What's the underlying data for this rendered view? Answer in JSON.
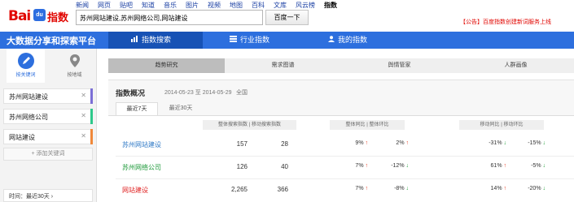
{
  "header": {
    "logo_text": "Bai",
    "logo_paw": "du",
    "logo_suffix": "指数",
    "nav": [
      "新闻",
      "网页",
      "贴吧",
      "知道",
      "音乐",
      "图片",
      "视频",
      "地图",
      "百科",
      "文库",
      "风云榜",
      "指数"
    ],
    "search_value": "苏州网站建设,苏州网络公司,网站建设",
    "search_button": "百度一下",
    "announcement": "【公告】百度指数创建新词服务上线"
  },
  "bluebar": {
    "brand": "大数据分享和探索平台",
    "nav": [
      {
        "label": "指数搜索",
        "icon": "chart-bar-icon"
      },
      {
        "label": "行业指数",
        "icon": "layers-icon"
      },
      {
        "label": "我的指数",
        "icon": "user-icon"
      }
    ]
  },
  "sidebar": {
    "tabs": [
      {
        "label": "按关键词",
        "icon": "pencil-icon"
      },
      {
        "label": "按地域",
        "icon": "map-pin-icon"
      }
    ],
    "keywords": [
      {
        "label": "苏州网站建设",
        "color": "#7b6fd6"
      },
      {
        "label": "苏州网络公司",
        "color": "#2ec98b"
      },
      {
        "label": "网站建设",
        "color": "#f0883a"
      }
    ],
    "add_keyword": "+ 添加关键词",
    "time": "时间：最近30天 ›"
  },
  "main": {
    "tabs": [
      "趋势研究",
      "需求图谱",
      "舆情管家",
      "人群画像"
    ],
    "title": "指数概况",
    "date_from": "2014-05-23",
    "date_to_sep": "至",
    "date_to": "2014-05-29",
    "region": "全国",
    "day_tabs": [
      "最近7天",
      "最近30天"
    ],
    "col_heads": [
      "整体搜索指数 | 移动搜索指数",
      "整体同比 | 整体环比",
      "移动同比 | 移动环比"
    ],
    "rows": [
      {
        "keyword": "苏州网站建设",
        "overall": "157",
        "mobile": "28",
        "yoy": "9%",
        "yoy_dir": "up",
        "mom": "2%",
        "mom_dir": "up",
        "m_yoy": "-31%",
        "m_yoy_dir": "down",
        "m_mom": "-15%",
        "m_mom_dir": "down",
        "color": "blue"
      },
      {
        "keyword": "苏州网络公司",
        "overall": "126",
        "mobile": "40",
        "yoy": "7%",
        "yoy_dir": "up",
        "mom": "-12%",
        "mom_dir": "down",
        "m_yoy": "61%",
        "m_yoy_dir": "up",
        "m_mom": "-5%",
        "m_mom_dir": "down",
        "color": "green"
      },
      {
        "keyword": "网站建设",
        "overall": "2,265",
        "mobile": "366",
        "yoy": "7%",
        "yoy_dir": "up",
        "mom": "-8%",
        "mom_dir": "down",
        "m_yoy": "14%",
        "m_yoy_dir": "up",
        "m_mom": "-20%",
        "m_mom_dir": "down",
        "color": "red"
      }
    ]
  }
}
